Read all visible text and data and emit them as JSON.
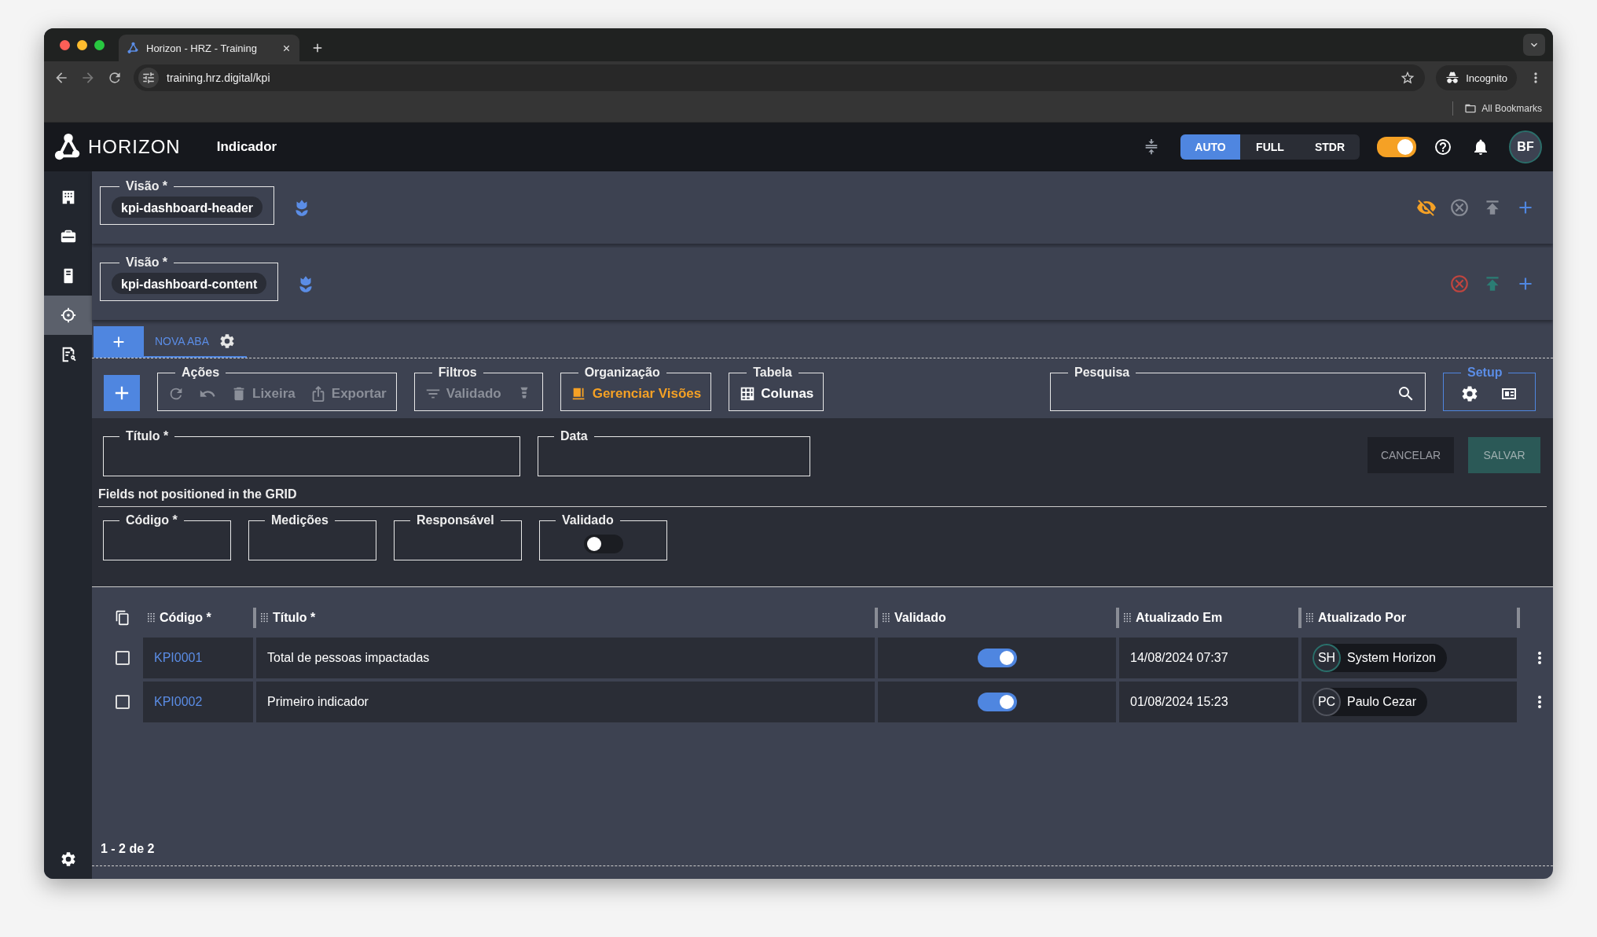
{
  "browser": {
    "tab_title": "Horizon - HRZ - Training",
    "url": "training.hrz.digital/kpi",
    "profile": "Incognito",
    "bookmarks": "All Bookmarks"
  },
  "header": {
    "logo": "HORIZON",
    "page_title": "Indicador",
    "modes": [
      {
        "label": "AUTO",
        "selected": true
      },
      {
        "label": "FULL",
        "selected": false
      },
      {
        "label": "STDR",
        "selected": false
      }
    ],
    "theme_toggle": {
      "on": true
    },
    "avatar": "BF"
  },
  "sidebar": {
    "items": [
      {
        "kind": "building",
        "selected": false
      },
      {
        "kind": "briefcase",
        "selected": false
      },
      {
        "kind": "device",
        "selected": false
      },
      {
        "kind": "target",
        "selected": true
      },
      {
        "kind": "report",
        "selected": false
      }
    ]
  },
  "views": [
    {
      "label": "Visão *",
      "value": "kpi-dashboard-header",
      "actions": [
        {
          "kind": "hide",
          "disabled": false
        },
        {
          "kind": "remove",
          "disabled": true
        },
        {
          "kind": "move-top",
          "disabled": true
        },
        {
          "kind": "add",
          "disabled": false
        }
      ]
    },
    {
      "label": "Visão *",
      "value": "kpi-dashboard-content",
      "actions": [
        {
          "kind": "remove",
          "disabled": false
        },
        {
          "kind": "move-top",
          "disabled": false
        },
        {
          "kind": "add",
          "disabled": false
        }
      ]
    }
  ],
  "tabs": [
    {
      "label": "NOVA ABA",
      "selected": true
    }
  ],
  "toolbar": {
    "groups": [
      {
        "legend": "Ações",
        "items": [
          {
            "kind": "refresh",
            "disabled": true
          },
          {
            "kind": "undo",
            "disabled": true
          },
          {
            "kind": "trash",
            "label": "Lixeira",
            "disabled": true
          },
          {
            "kind": "export",
            "label": "Exportar",
            "disabled": true
          }
        ]
      },
      {
        "legend": "Filtros",
        "items": [
          {
            "kind": "filter",
            "label": "Validado",
            "disabled": true
          },
          {
            "kind": "filter-clear",
            "disabled": true
          }
        ]
      },
      {
        "legend": "Organização",
        "items": [
          {
            "kind": "views",
            "label": "Gerenciar Visões",
            "disabled": false
          }
        ]
      },
      {
        "legend": "Tabela",
        "items": [
          {
            "kind": "columns",
            "label": "Colunas",
            "disabled": false
          }
        ]
      }
    ],
    "search": {
      "legend": "Pesquisa"
    },
    "setup": {
      "legend": "Setup"
    }
  },
  "form": {
    "fields": [
      {
        "label": "Título *"
      },
      {
        "label": "Data"
      }
    ],
    "cancel": "CANCELAR",
    "save": "SALVAR",
    "section": "Fields not positioned in the GRID",
    "extra_fields": [
      {
        "label": "Código *",
        "kind": "text"
      },
      {
        "label": "Medições",
        "kind": "text"
      },
      {
        "label": "Responsável",
        "kind": "text"
      },
      {
        "label": "Validado",
        "kind": "toggle",
        "on": false
      }
    ]
  },
  "table": {
    "columns": [
      "Código *",
      "Título *",
      "Validado",
      "Atualizado Em",
      "Atualizado Por"
    ],
    "rows": [
      {
        "checked": false,
        "code": "KPI0001",
        "title": "Total de pessoas impactadas",
        "validated": true,
        "updated_at": "14/08/2024 07:37",
        "user": {
          "initials": "SH",
          "name": "System Horizon",
          "color": "#2b6e6a"
        }
      },
      {
        "checked": false,
        "code": "KPI0002",
        "title": "Primeiro indicador",
        "validated": true,
        "updated_at": "01/08/2024 15:23",
        "user": {
          "initials": "PC",
          "name": "Paulo Cezar",
          "color": "#50535d"
        }
      }
    ],
    "pagination": "1 - 2 de 2"
  }
}
